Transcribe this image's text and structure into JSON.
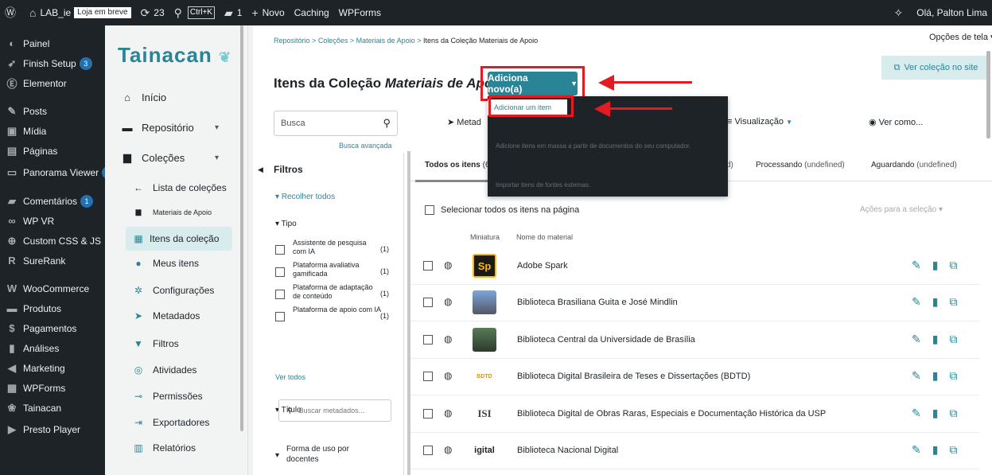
{
  "adminbar": {
    "site_name": "LAB_ie",
    "store_badge": "Loja em breve",
    "updates": "23",
    "search_shortcut": "Ctrl+K",
    "comments": "1",
    "new": "Novo",
    "caching": "Caching",
    "wpforms": "WPForms",
    "greeting": "Olá, Palton Lima"
  },
  "adminmenu": [
    {
      "label": "Painel",
      "icon": "dashboard-icon",
      "glyph": "◐"
    },
    {
      "label": "Finish Setup",
      "icon": "rocket-icon",
      "glyph": "➶",
      "badge": "3"
    },
    {
      "label": "Elementor",
      "icon": "elementor-icon",
      "glyph": "Ⓔ"
    },
    {
      "label": "Posts",
      "icon": "pin-icon",
      "glyph": "✎"
    },
    {
      "label": "Mídia",
      "icon": "media-icon",
      "glyph": "▣"
    },
    {
      "label": "Páginas",
      "icon": "pages-icon",
      "glyph": "▤"
    },
    {
      "label": "Panorama Viewer",
      "icon": "panorama-icon",
      "glyph": "▭",
      "badge": "1"
    },
    {
      "label": "Comentários",
      "icon": "comment-icon",
      "glyph": "▰",
      "badge": "1"
    },
    {
      "label": "WP VR",
      "icon": "vr-icon",
      "glyph": "∞"
    },
    {
      "label": "Custom CSS & JS",
      "icon": "plus-circle-icon",
      "glyph": "⊕"
    },
    {
      "label": "SureRank",
      "icon": "surerank-icon",
      "glyph": "R"
    },
    {
      "label": "WooCommerce",
      "icon": "woo-icon",
      "glyph": "W"
    },
    {
      "label": "Produtos",
      "icon": "products-icon",
      "glyph": "▬"
    },
    {
      "label": "Pagamentos",
      "icon": "payments-icon",
      "glyph": "$"
    },
    {
      "label": "Análises",
      "icon": "analytics-icon",
      "glyph": "▮"
    },
    {
      "label": "Marketing",
      "icon": "megaphone-icon",
      "glyph": "◀"
    },
    {
      "label": "WPForms",
      "icon": "forms-icon",
      "glyph": "▦"
    },
    {
      "label": "Tainacan",
      "icon": "tainacan-icon",
      "glyph": "❀"
    },
    {
      "label": "Presto Player",
      "icon": "play-icon",
      "glyph": "▶"
    }
  ],
  "tnav": {
    "logo": "Tainacan",
    "inicio": "Início",
    "repositorio": "Repositório",
    "colecoes": "Coleções",
    "lista": "Lista de coleções",
    "materiais": "Materiais de Apoio",
    "itens": "Itens da coleção",
    "meus": "Meus itens",
    "config": "Configurações",
    "metadados": "Metadados",
    "filtros": "Filtros",
    "atividades": "Atividades",
    "permissoes": "Permissões",
    "exportadores": "Exportadores",
    "relatorios": "Relatórios"
  },
  "breadcrumb": {
    "repo": "Repositório",
    "sep": ">",
    "colecoes": "Coleções",
    "materiais": "Materiais de Apoio",
    "current": "Itens da Coleção Materiais de Apoio"
  },
  "screen_options": "Opções de tela",
  "view_collection": "Ver coleção no site",
  "title_prefix": "Itens da Coleção",
  "title_em": "Materiais de Apoio",
  "add_new": "Adiciona novo(a)",
  "dropdown": {
    "add_item": "Adicionar um item",
    "bulk": "Adicione itens em massa a partir de documentos do seu computador.",
    "import": "Importar itens de fontes externas."
  },
  "search": {
    "placeholder": "Busca",
    "advanced": "Busca avançada"
  },
  "toolbar": {
    "metadados": "Metad",
    "visualizacao": "Visualização",
    "ver_como": "Ver como..."
  },
  "filters": {
    "title": "Filtros",
    "collapse": "Recolher todos",
    "tipo": "Tipo",
    "options": [
      {
        "label": "Assistente de pesquisa com IA",
        "count": "(1)"
      },
      {
        "label": "Plataforma avaliativa gamificada",
        "count": "(1)"
      },
      {
        "label": "Plataforma de adaptação de conteúdo",
        "count": "(1)"
      },
      {
        "label": "Plataforma de apoio com IA",
        "count": "(1)"
      }
    ],
    "ver_todos": "Ver todos",
    "titulo": "Título",
    "buscar_metadados": "Buscar metadados...",
    "forma_uso": "Forma de uso por docentes"
  },
  "tabs": {
    "todos": "Todos os itens",
    "todos_count": "(6",
    "mid_tail": "d)",
    "processando": "Processando",
    "aguardando": "Aguardando",
    "undefined": "(undefined)"
  },
  "list": {
    "select_all": "Selecionar todos os itens na página",
    "bulk_actions": "Ações para a seleção",
    "col_thumb": "Miniatura",
    "col_name": "Nome do material",
    "rows": [
      {
        "name": "Adobe Spark",
        "thumb": "Sp"
      },
      {
        "name": "Biblioteca Brasiliana Guita e José Mindlin",
        "thumb": ""
      },
      {
        "name": "Biblioteca Central da Universidade de Brasília",
        "thumb": ""
      },
      {
        "name": "Biblioteca Digital Brasileira de Teses e Dissertações (BDTD)",
        "thumb": "BDTD"
      },
      {
        "name": "Biblioteca Digital de Obras Raras, Especiais e Documentação Histórica da USP",
        "thumb": "ISI"
      },
      {
        "name": "Biblioteca Nacional Digital",
        "thumb": "igital"
      }
    ]
  },
  "colors": {
    "accent": "#298596",
    "highlight_red": "#e51b23",
    "admin_dark": "#1d2327"
  }
}
